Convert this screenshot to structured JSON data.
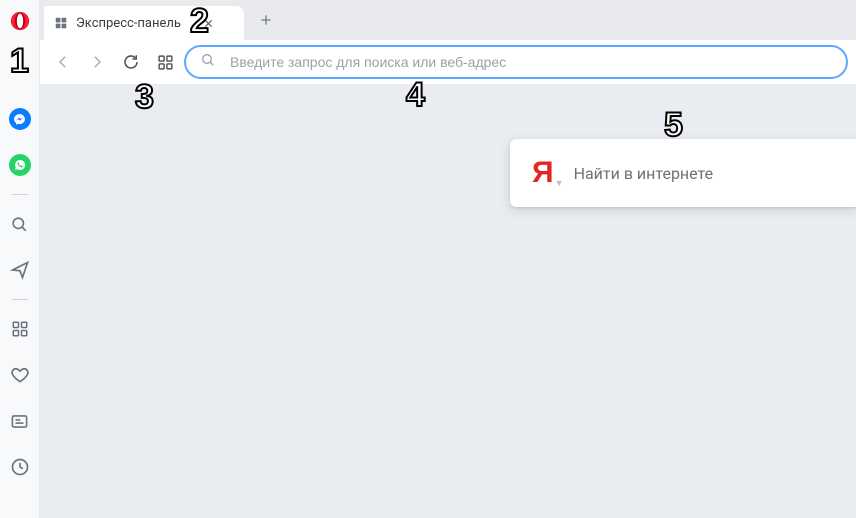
{
  "annotations": {
    "a1": "1",
    "a2": "2",
    "a3": "3",
    "a4": "4",
    "a5": "5"
  },
  "tab": {
    "title": "Экспресс-панель"
  },
  "addressbar": {
    "placeholder": "Введите запрос для поиска или веб-адрес",
    "value": ""
  },
  "yandex": {
    "logo_letter": "Я",
    "placeholder": "Найти в интернете"
  },
  "sidebar": {
    "items": [
      {
        "name": "messenger"
      },
      {
        "name": "whatsapp"
      },
      {
        "name": "separator"
      },
      {
        "name": "search"
      },
      {
        "name": "send"
      },
      {
        "name": "separator"
      },
      {
        "name": "speed-dial"
      },
      {
        "name": "bookmarks-heart"
      },
      {
        "name": "news"
      },
      {
        "name": "history"
      }
    ]
  }
}
